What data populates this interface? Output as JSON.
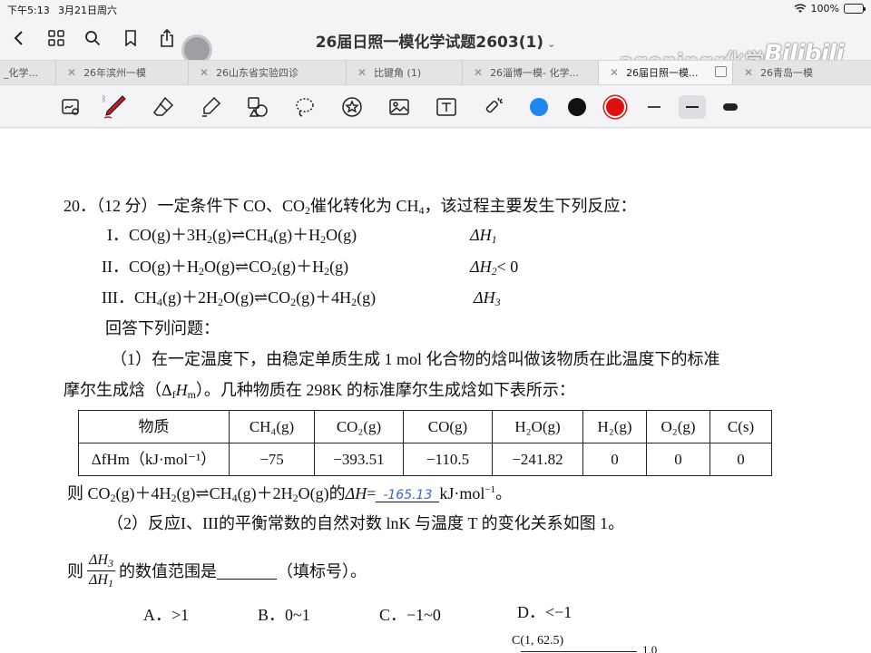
{
  "status_bar": {
    "time": "下午5:13",
    "date": "3月21日周六",
    "battery": "100%"
  },
  "nav": {
    "title": "26届日照一模化学试题2603(1)",
    "watermark": "ageningr化学",
    "bilibili": "Bilibili"
  },
  "tabs": [
    {
      "label": "_化学..."
    },
    {
      "label": "26年滨州一模"
    },
    {
      "label": "26山东省实验四诊"
    },
    {
      "label": "比键角 (1)"
    },
    {
      "label": "26淄博一模- 化学..."
    },
    {
      "label": "26届日照一模..."
    },
    {
      "label": "26青岛一模"
    }
  ],
  "toolbar": {
    "colors": [
      "#1e88f0",
      "#111111",
      "#e01010"
    ],
    "tools": [
      "lasso-zoom-icon",
      "pen-icon",
      "eraser-icon",
      "highlighter-icon",
      "shapes-icon",
      "lasso-icon",
      "sticker-icon",
      "image-icon",
      "text-icon",
      "laser-icon"
    ]
  },
  "question": {
    "header": "20．（12 分）一定条件下 CO、CO",
    "header_mid": "催化转化为 CH",
    "header_end": "，该过程主要发生下列反应：",
    "r1_label": "I．",
    "r2_label": "II．",
    "r3_label": "III．",
    "dH1": "ΔH",
    "dH2_tail": "< 0",
    "intro": "回答下列问题：",
    "p1_line1": "（1）在一定温度下，由稳定单质生成 1 mol 化合物的焓叫做该物质在此温度下的标准",
    "p1_line2_a": "摩尔生成焓（Δ",
    "p1_line2_b": "）。几种物质在 298K 的标准摩尔生成焓如下表所示：",
    "table": {
      "header": [
        "物质",
        "CH₄(g)",
        "CO₂(g)",
        "CO(g)",
        "H₂O(g)",
        "H₂(g)",
        "O₂(g)",
        "C(s)"
      ],
      "row_label": "ΔfHm（kJ·mol⁻¹）",
      "values": [
        "−75",
        "−393.51",
        "−110.5",
        "−241.82",
        "0",
        "0",
        "0"
      ]
    },
    "q1_prefix": "则 CO",
    "q1_tail": "的",
    "q1_unit": "kJ·mol",
    "handwritten_answer": "-165.13",
    "p2": "（2）反应I、III的平衡常数的自然对数 lnK 与温度 T 的变化关系如图 1。",
    "p2_ask_a": "则",
    "p2_ask_b": "的数值范围是",
    "p2_ask_c": "（填标号）。",
    "options": [
      "A．>1",
      "B．0~1",
      "C．−1~0",
      "D．<−1"
    ],
    "graph_label": "C(1, 62.5)",
    "graph_tick": "1.0"
  }
}
